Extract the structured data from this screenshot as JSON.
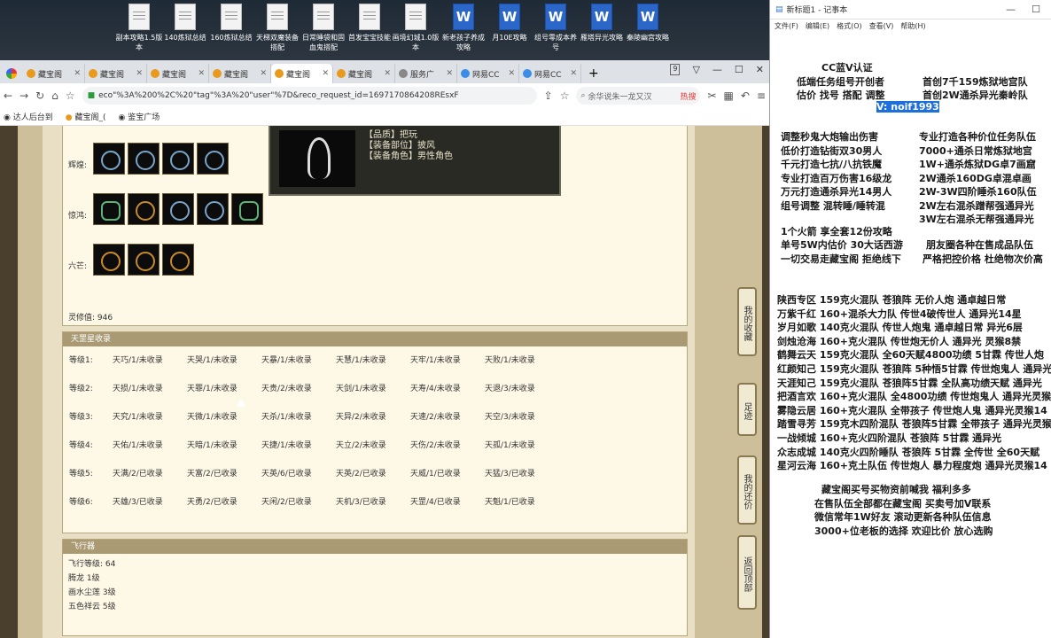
{
  "desktop": {
    "icons": [
      {
        "label": "副本攻略1.5版本",
        "type": "file"
      },
      {
        "label": "140炼狱总结",
        "type": "file"
      },
      {
        "label": "160炼狱总结",
        "type": "file"
      },
      {
        "label": "天梯双魔装备搭配",
        "type": "file"
      },
      {
        "label": "日常睡袋和固血鬼搭配",
        "type": "file"
      },
      {
        "label": "首发宝宝技能",
        "type": "file"
      },
      {
        "label": "画境幻城1.0版本",
        "type": "file"
      },
      {
        "label": "新老孩子养成攻略",
        "type": "word"
      },
      {
        "label": "月10E攻略",
        "type": "word"
      },
      {
        "label": "组号零成本养号",
        "type": "word"
      },
      {
        "label": "雁塔异光攻略",
        "type": "word"
      },
      {
        "label": "秦陵幽宫攻略",
        "type": "word"
      }
    ]
  },
  "browser": {
    "tabs": [
      {
        "label": "藏宝阁"
      },
      {
        "label": "藏宝阁"
      },
      {
        "label": "藏宝阁"
      },
      {
        "label": "藏宝阁"
      },
      {
        "label": "藏宝阁"
      },
      {
        "label": "藏宝阁"
      },
      {
        "label": "服务广"
      },
      {
        "label": "网易CC"
      },
      {
        "label": "网易CC"
      }
    ],
    "tab_count": "9",
    "address": "eco\"%3A%200%2C%20\"tag\"%3A%20\"user\"%7D&reco_request_id=1697170864208REsxF",
    "search_placeholder": "余华说朱一龙又汉",
    "hot_label": "热搜",
    "bookmarks": [
      "达人后台到",
      "藏宝阁_(",
      "鉴宝广场"
    ]
  },
  "game": {
    "tooltip_lines": [
      "【品质】把玩",
      "【装备部位】披风",
      "【装备角色】男性角色"
    ],
    "rows": [
      {
        "label": "辉煌:"
      },
      {
        "label": "惊鸿:"
      },
      {
        "label": "六芒:"
      }
    ],
    "spirit_label": "灵修值: 946",
    "collection_title": "天罡星收录",
    "grades": [
      "等级1:",
      "等级2:",
      "等级3:",
      "等级4:",
      "等级5:",
      "等级6:"
    ],
    "collection": [
      [
        "天巧/1/未收录",
        "天哭/1/未收录",
        "天暴/1/未收录",
        "天慧/1/未收录",
        "天牢/1/未收录",
        "天败/1/未收录"
      ],
      [
        "天损/1/未收录",
        "天罪/1/未收录",
        "天贵/2/未收录",
        "天剑/1/未收录",
        "天寿/4/未收录",
        "天退/3/未收录"
      ],
      [
        "天究/1/未收录",
        "天微/1/未收录",
        "天杀/1/未收录",
        "天异/2/未收录",
        "天速/2/未收录",
        "天空/3/未收录"
      ],
      [
        "天佑/1/未收录",
        "天暗/1/未收录",
        "天捷/1/未收录",
        "天立/2/未收录",
        "天伤/2/未收录",
        "天孤/1/未收录"
      ],
      [
        "天满/2/已收录",
        "天富/2/已收录",
        "天英/6/已收录",
        "天英/2/已收录",
        "天威/1/已收录",
        "天猛/3/已收录"
      ],
      [
        "天雄/3/已收录",
        "天勇/2/已收录",
        "天闲/2/已收录",
        "天机/3/已收录",
        "天罡/4/已收录",
        "天魁/1/已收录"
      ]
    ],
    "fly_title": "飞行器",
    "fly_lines": [
      "飞行等级: 64",
      "腾龙  1级",
      "画水尘莲  3级",
      "五色祥云  5级"
    ],
    "side_buttons": [
      "我的收藏",
      "足迹",
      "我的还价",
      "返回顶部"
    ]
  },
  "notepad": {
    "title": "新标题1 - 记事本",
    "menu": [
      "文件(F)",
      "编辑(E)",
      "格式(O)",
      "查看(V)",
      "帮助(H)"
    ],
    "header_lines": [
      "CC蓝V认证",
      "低端任务组号开创者",
      "首创7千159炼狱地宫队",
      "估价 找号 搭配 调整",
      "首创2W通杀异光秦岭队"
    ],
    "highlight": "V: noif1993",
    "left_col": [
      "调整秒鬼大炮输出伤害",
      "低价打造钻街双30男人",
      "千元打造七抗/八抗铁魔",
      "专业打造百万伤害16级龙",
      "万元打造通杀异光14男人",
      "组号调整 混转睡/睡转混"
    ],
    "right_col": [
      "专业打造各种价位任务队伍",
      "7000+通杀日常炼狱地宫",
      "1W+通杀炼狱DG卓7画窟",
      "2W通杀160DG卓混卓画",
      "2W-3W四阶睡杀160队伍",
      "2W左右混杀蹭帮强通异光",
      "3W左右混杀无帮强通异光"
    ],
    "mid_lines": [
      "1个火箭 享全套12份攻略",
      "单号5W内估价 30大话西游",
      "朋友圈各种在售成品队伍",
      "一切交易走藏宝阁 拒绝线下",
      "严格把控价格 杜绝物次价高"
    ],
    "teams": [
      "陕西专区 159克火混队 苍狼阵 无价人炮 通卓越日常",
      "万紫千红 160+混杀大力队 传世4破传世人 通异光14星",
      "岁月如歌 140克火混队 传世人炮鬼 通卓越日常 异光6层",
      "剑烛沧海 160+克火混队 传世炮无价人 通异光 灵猴8禁",
      "鹤舞云天 159克火混队 全60天赋4800功绩 5甘霖 传世人炮",
      "红颜知己 159克火混队 苍狼阵 5种悟5甘霖 传世炮鬼人 通异光",
      "天涯知己 159克火混队 苍狼阵5甘霖 全队高功绩天赋 通异光",
      "把酒言欢 160+克火混队 全4800功绩 传世炮鬼人 通异光灵猴",
      "雾隐云居 160+克火混队 全带孩子 传世炮人鬼 通异光灵猴14",
      "踏雪寻芳 159克木四阶混队 苍狼阵5甘霖 全带孩子 通异光灵猴",
      "一战倾城 160+克火四阶混队 苍狼阵 5甘霖 通异光",
      "众志成城 140克火四阶睡队 苍狼阵 5甘霖 全传世 全60天赋",
      "星河云海 160+克土队伍 传世炮人 暴力程度炮 通异光灵猴14"
    ],
    "footer_lines": [
      "藏宝阁买号买物资前喊我 福利多多",
      "在售队伍全部都在藏宝阁 买卖号加V联系",
      "微信常年1W好友 滚动更新各种队伍信息",
      "3000+位老板的选择 欢迎比价 放心选购"
    ]
  }
}
